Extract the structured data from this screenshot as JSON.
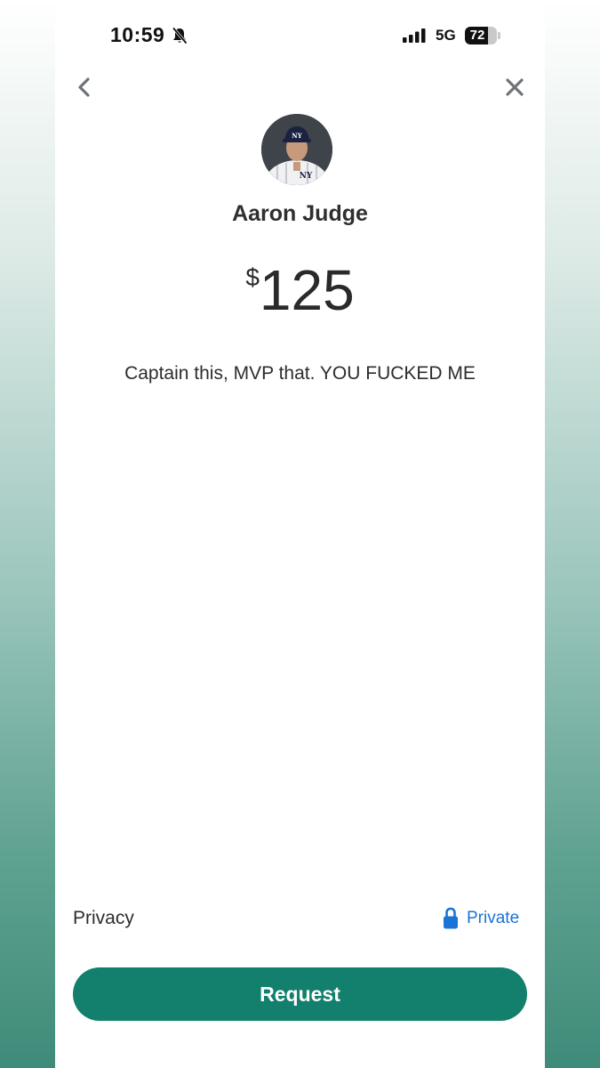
{
  "status_bar": {
    "time": "10:59",
    "network": "5G",
    "battery": "72",
    "battery_level": 0.72,
    "icons": [
      "bell-slash-icon",
      "signal-bars-icon",
      "battery-icon"
    ]
  },
  "nav": {
    "back_icon": "chevron-left-icon",
    "close_icon": "close-icon"
  },
  "recipient": {
    "name": "Aaron Judge",
    "avatar_icon": "avatar-photo"
  },
  "payment": {
    "currency_symbol": "$",
    "amount": "125",
    "note": "Captain this, MVP that. YOU FUCKED ME"
  },
  "privacy": {
    "label": "Privacy",
    "value": "Private",
    "icon": "lock-icon"
  },
  "actions": {
    "request_label": "Request"
  },
  "colors": {
    "accent_green": "#12806c",
    "link_blue": "#1a73d6"
  }
}
